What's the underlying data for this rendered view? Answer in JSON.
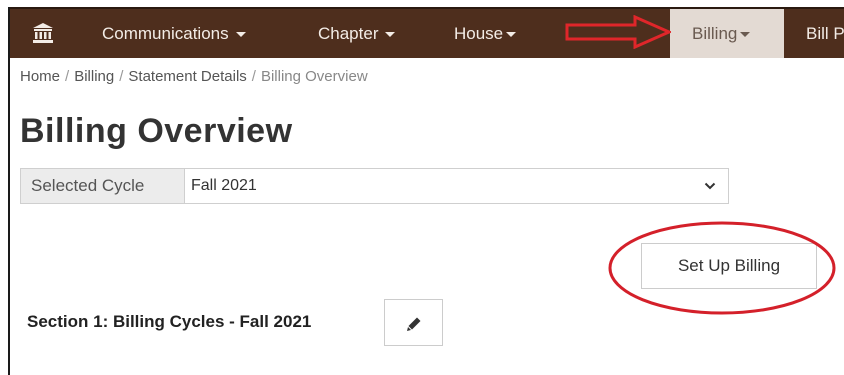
{
  "navbar": {
    "logo_icon": "bank-building-icon",
    "items": [
      {
        "label": "Communications",
        "dropdown": true
      },
      {
        "label": "Chapter",
        "dropdown": true
      },
      {
        "label": "House",
        "dropdown": true
      },
      {
        "label": "Billing",
        "dropdown": true,
        "active": true
      },
      {
        "label": "Bill P",
        "dropdown": false
      }
    ],
    "background_color": "#4e2e1d",
    "active_color": "#e3dad3"
  },
  "breadcrumb": {
    "items": [
      "Home",
      "Billing",
      "Statement Details",
      "Billing Overview"
    ],
    "separator": "/"
  },
  "page": {
    "title": "Billing Overview"
  },
  "cycle": {
    "label": "Selected Cycle",
    "selected": "Fall 2021"
  },
  "actions": {
    "setup_label": "Set Up Billing"
  },
  "section": {
    "title": "Section 1: Billing Cycles - Fall 2021",
    "edit_icon": "pencil-icon"
  },
  "annotations": {
    "arrow_color": "#e0262a",
    "circle_color": "#d4202a"
  }
}
